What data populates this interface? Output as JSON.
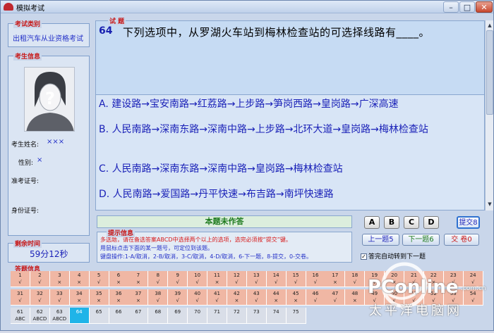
{
  "window": {
    "title": "模拟考试",
    "min": "–",
    "max": "□",
    "close": "✕"
  },
  "exam_category": {
    "label": "考试类别",
    "value": "出租汽车从业资格考试"
  },
  "examinee": {
    "label": "考生信息",
    "name_label": "考生姓名:",
    "name_value": "×××",
    "gender_label": "性别:",
    "gender_value": "×",
    "admission_label": "准考证号:",
    "admission_value": "",
    "id_label": "身份证号:",
    "id_value": ""
  },
  "time": {
    "label": "剩余时间",
    "value": "59分12秒"
  },
  "question": {
    "label": "试 题",
    "number": "64",
    "text": "下列选项中，从罗湖火车站到梅林检查站的可选择线路有____。",
    "options": [
      "A. 建设路→宝安南路→红荔路→上步路→笋岗西路→皇岗路→广深高速",
      "B. 人民南路→深南东路→深南中路→上步路→北环大道→皇岗路→梅林检查站",
      "C. 人民南路→深南东路→深南中路→皇岗路→梅林检查站",
      "D. 人民南路→爱国路→丹平快速→布吉路→南坪快速路"
    ]
  },
  "status": "本题未作答",
  "hints": {
    "label": "提示信息",
    "lines": [
      "多选题，请在备选答案ABCD中选择两个以上的选项，选完必须按“提交”键。",
      "用鼠标点击下面的某一题号，可定位到该题。",
      "键盘操作:1-A/取消，2-B/取消，3-C/取消，4-D/取消，6-下一题，8-提交，0-交卷。"
    ]
  },
  "answer_buttons": [
    "A",
    "B",
    "C",
    "D"
  ],
  "controls": {
    "submit": "提交8",
    "prev": "上一题5",
    "next": "下一题6",
    "hand_in": "交 卷0",
    "auto_next": "答完自动转到下一题"
  },
  "answer_info": {
    "label": "答题信息",
    "rows": [
      [
        {
          "n": "1",
          "a": "√"
        },
        {
          "n": "2",
          "a": "√"
        },
        {
          "n": "3",
          "a": "×"
        },
        {
          "n": "4",
          "a": "×"
        },
        {
          "n": "5",
          "a": "√"
        },
        {
          "n": "6",
          "a": "×"
        },
        {
          "n": "7",
          "a": "×"
        },
        {
          "n": "8",
          "a": "√"
        },
        {
          "n": "9",
          "a": "√"
        },
        {
          "n": "10",
          "a": "√"
        },
        {
          "n": "11",
          "a": "×"
        },
        {
          "n": "12",
          "a": "√"
        },
        {
          "n": "13",
          "a": "√"
        },
        {
          "n": "14",
          "a": "√"
        },
        {
          "n": "15",
          "a": "√"
        },
        {
          "n": "16",
          "a": "√"
        },
        {
          "n": "17",
          "a": "×"
        },
        {
          "n": "18",
          "a": "√"
        },
        {
          "n": "19",
          "a": "√"
        },
        {
          "n": "20",
          "a": "×"
        },
        {
          "n": "21",
          "a": "√"
        },
        {
          "n": "22",
          "a": "×"
        },
        {
          "n": "23",
          "a": "√"
        },
        {
          "n": "24",
          "a": "√"
        }
      ],
      [
        {
          "n": "31",
          "a": "√"
        },
        {
          "n": "32",
          "a": "√"
        },
        {
          "n": "33",
          "a": "√"
        },
        {
          "n": "34",
          "a": "×"
        },
        {
          "n": "35",
          "a": "×"
        },
        {
          "n": "36",
          "a": "×"
        },
        {
          "n": "37",
          "a": "×"
        },
        {
          "n": "38",
          "a": "√"
        },
        {
          "n": "39",
          "a": "√"
        },
        {
          "n": "40",
          "a": "√"
        },
        {
          "n": "41",
          "a": "√"
        },
        {
          "n": "42",
          "a": "×"
        },
        {
          "n": "43",
          "a": "√"
        },
        {
          "n": "44",
          "a": "×"
        },
        {
          "n": "45",
          "a": "×"
        },
        {
          "n": "46",
          "a": "√"
        },
        {
          "n": "47",
          "a": "√"
        },
        {
          "n": "48",
          "a": "×"
        },
        {
          "n": "49",
          "a": "√"
        },
        {
          "n": "50",
          "a": "√"
        },
        {
          "n": "51",
          "a": "√"
        },
        {
          "n": "52",
          "a": "√"
        },
        {
          "n": "53",
          "a": "√"
        },
        {
          "n": "54",
          "a": "√"
        }
      ],
      [
        {
          "n": "61",
          "a": "ABC"
        },
        {
          "n": "62",
          "a": "ABCD"
        },
        {
          "n": "63",
          "a": "ABCD"
        },
        {
          "n": "64",
          "a": ""
        },
        {
          "n": "65",
          "a": ""
        },
        {
          "n": "66",
          "a": ""
        },
        {
          "n": "67",
          "a": ""
        },
        {
          "n": "68",
          "a": ""
        },
        {
          "n": "69",
          "a": ""
        },
        {
          "n": "70",
          "a": ""
        },
        {
          "n": "71",
          "a": ""
        },
        {
          "n": "72",
          "a": ""
        },
        {
          "n": "73",
          "a": ""
        },
        {
          "n": "74",
          "a": ""
        },
        {
          "n": "75",
          "a": ""
        }
      ]
    ],
    "current": "64"
  },
  "watermark": {
    "brand": "PConline",
    "suffix": ".com.cn",
    "cn": "太平洋电脑网"
  }
}
